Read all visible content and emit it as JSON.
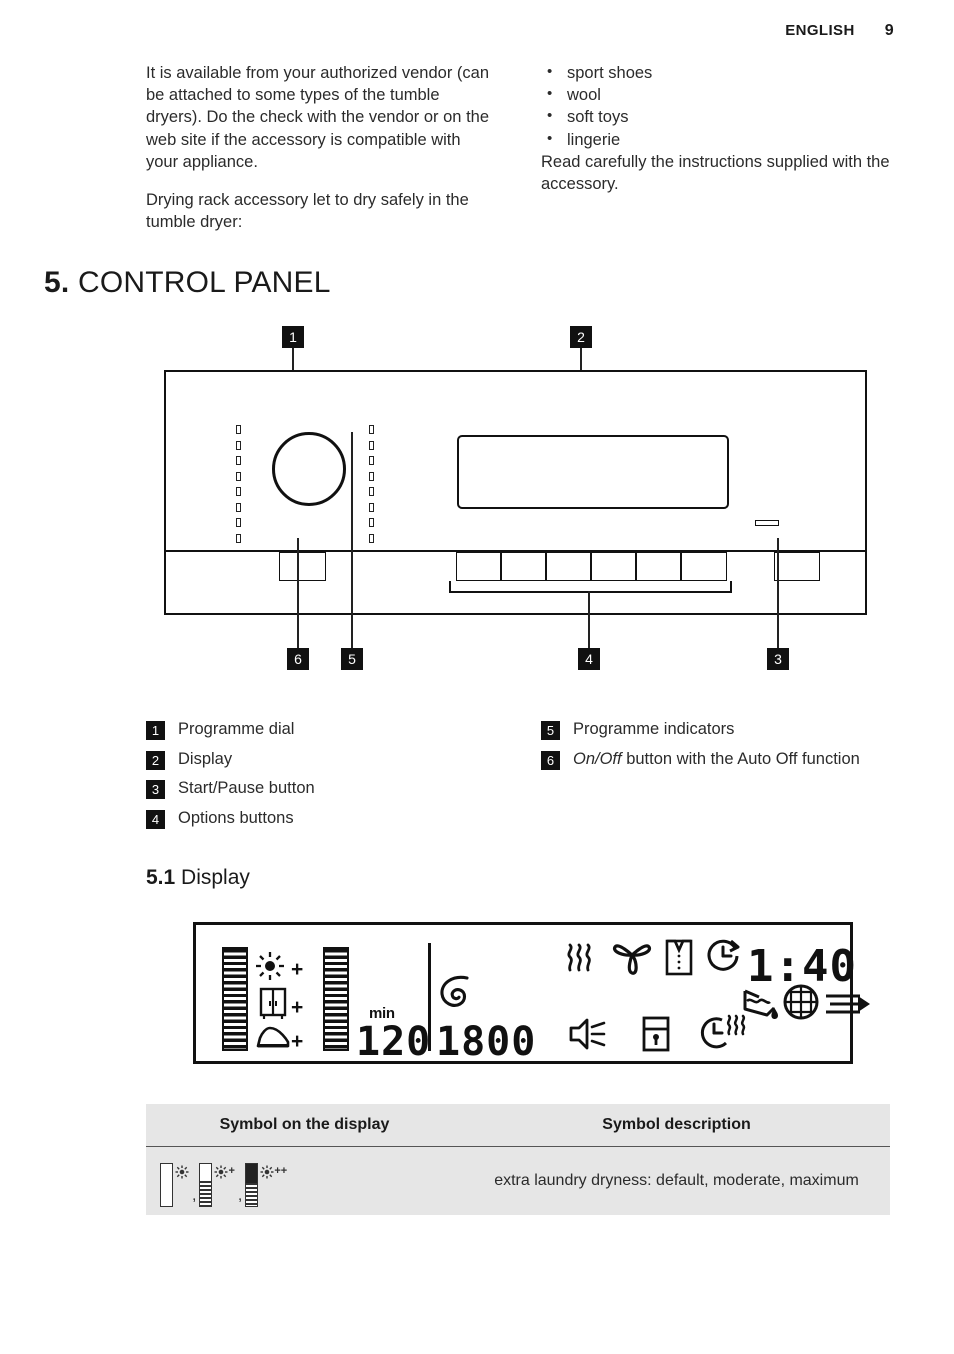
{
  "header": {
    "language": "ENGLISH",
    "page_number": "9"
  },
  "intro": {
    "left_paragraphs": [
      "It is available from your authorized vendor (can be attached to some types of the tumble dryers). Do the check with the vendor or on the web site if the accessory is compatible with your appliance.",
      "Drying rack accessory let to dry safely in the tumble dryer:"
    ],
    "right_bullets": [
      "sport shoes",
      "wool",
      "soft toys",
      "lingerie"
    ],
    "right_paragraph": "Read carefully the instructions supplied with the accessory."
  },
  "section": {
    "number": "5.",
    "title": "CONTROL PANEL"
  },
  "panel_figure": {
    "callouts": [
      "1",
      "2",
      "3",
      "4",
      "5",
      "6"
    ],
    "tick_count_left": 8,
    "tick_count_right": 8,
    "option_button_count": 6
  },
  "legend": {
    "left": [
      {
        "num": "1",
        "label": "Programme dial"
      },
      {
        "num": "2",
        "label": "Display"
      },
      {
        "num": "3",
        "label": "Start/Pause button"
      },
      {
        "num": "4",
        "label": "Options buttons"
      }
    ],
    "right": [
      {
        "num": "5",
        "label": "Programme indicators"
      },
      {
        "num": "6",
        "label_italic": "On/Off",
        "label_rest": " button with the Auto Off function"
      }
    ]
  },
  "subsection": {
    "number": "5.1",
    "title": "Display"
  },
  "display": {
    "min_label": "min",
    "time_value": "120",
    "rpm_value": "1800",
    "remaining_time": "1:40",
    "icons": [
      "heat-waves-icon",
      "wool-icon",
      "shirt-icon",
      "delay-start-icon",
      "water-container-icon",
      "filter-icon",
      "airflow-icon",
      "buzzer-icon",
      "child-lock-icon",
      "anti-crease-icon",
      "sun-icon",
      "cupboard-dry-icon",
      "iron-dry-icon",
      "spiral-icon"
    ]
  },
  "symbol_table": {
    "headers": [
      "Symbol on the display",
      "Symbol description"
    ],
    "rows": [
      {
        "symbol_name": "extra-dryness-levels",
        "description": "extra laundry dryness: default, moderate, maximum"
      }
    ]
  },
  "colors": {
    "ink": "#1a1a1a",
    "table_bg": "#e6e6e6",
    "callout_bg": "#111111"
  }
}
